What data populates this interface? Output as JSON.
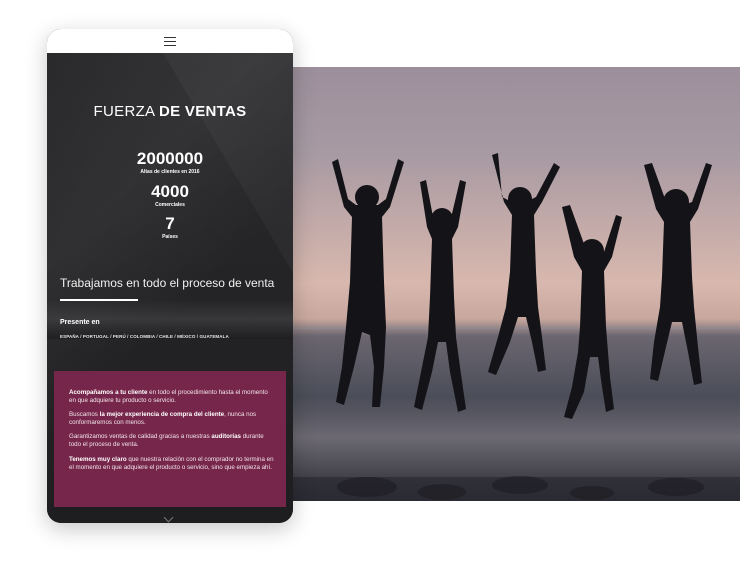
{
  "hero_title": {
    "light": "FUERZA",
    "bold": "DE VENTAS"
  },
  "stats": [
    {
      "number": "2000000",
      "label": "Altas de clientes en 2016"
    },
    {
      "number": "4000",
      "label": "Comerciales"
    },
    {
      "number": "7",
      "label": "Países"
    }
  ],
  "process_heading": "Trabajamos en todo el proceso de venta",
  "presence": {
    "title": "Presente en",
    "countries": "ESPAÑA / PORTUGAL / PERÚ / COLOMBIA / CHILE / MÉXICO / GUATEMALA"
  },
  "info_box": {
    "p1_bold": "Acompañamos a tu cliente",
    "p1_rest": " en todo el procedimiento hasta el momento en que adquiere tu producto o servicio.",
    "p2_pre": "Buscamos ",
    "p2_bold": "la mejor experiencia de compra del cliente",
    "p2_rest": ", nunca nos conformaremos con menos.",
    "p3_pre": "Garantizamos ventas de calidad gracias a nuestras ",
    "p3_bold": "auditorías",
    "p3_rest": " durante todo el proceso de venta.",
    "p4_bold": "Tenemos muy claro",
    "p4_rest": " que nuestra relación con el comprador no termina en el momento en que adquiere el producto o servicio, sino que empieza ahí."
  },
  "colors": {
    "maroon": "#76264b",
    "dark": "#1e1e20"
  },
  "icons": {
    "menu": "hamburger-icon",
    "scroll": "chevron-down-icon"
  }
}
